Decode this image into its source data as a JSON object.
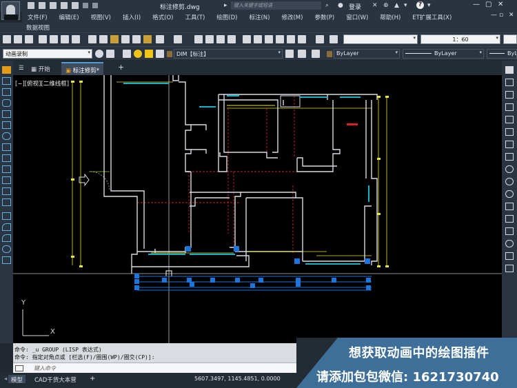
{
  "titlebar": {
    "document_title": "标注修剪.dwg",
    "search_placeholder": "键入关键字或短语",
    "login_label": "登录",
    "help_icon": "?"
  },
  "menu": {
    "items": [
      "文件(F)",
      "编辑(E)",
      "视图(V)",
      "插入(I)",
      "格式(O)",
      "工具(T)",
      "绘图(D)",
      "标注(N)",
      "修改(M)",
      "参数(P)",
      "窗口(W)",
      "帮助(H)",
      "ET扩展工具(X)"
    ],
    "second_row": "数据视图"
  },
  "toolbar": {
    "scale_value": "1：60",
    "named_view": "动画录制",
    "dim_style": "DIM【标注】",
    "color_value": "ByLayer",
    "linetype_value": "ByLayer",
    "lineweight_value": "ByLayer"
  },
  "file_tabs": {
    "start": "开始",
    "active": "标注修剪*",
    "add": "+"
  },
  "viewport": {
    "label": "[−][俯视][二维线框]",
    "ucs_x": "X",
    "ucs_y": "Y"
  },
  "command": {
    "line1": "命令: _u GROUP (LISP 表达式)",
    "line2": "命令: 指定对角点或 [栏选(F)/圈围(WP)/圈交(CP)]:",
    "input_placeholder": "键入命令"
  },
  "status": {
    "model_tab": "模型",
    "layout_tab": "CAD千货大本营",
    "add_tab": "+",
    "coords": "5607.3497, 1145.4851, 0.0000"
  },
  "promo": {
    "line1": "想获取动画中的绘图插件",
    "line2": "请添加包包微信: 1621730740"
  },
  "colors": {
    "wall": "#d9dde2",
    "window_cyan": "#19b3c9",
    "dim_yellow": "#e8e63b",
    "hidden_red": "#c0242d",
    "grip_blue": "#1e74d8",
    "promo_bg": "#3e6f98"
  }
}
